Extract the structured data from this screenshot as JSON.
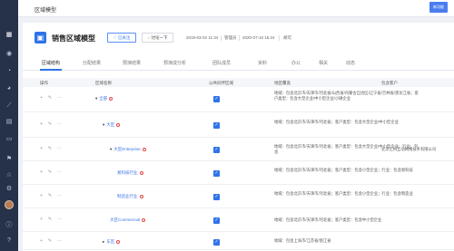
{
  "top": {
    "title": "区域模型",
    "badge": "新功能"
  },
  "sidebar": {
    "icons": [
      "grid-icon",
      "user-icon",
      "clock-icon",
      "pie-icon",
      "chart-line-icon",
      "list-icon",
      "monitor-icon",
      "flag-icon",
      "star-icon",
      "gear-icon",
      "info-icon"
    ]
  },
  "header": {
    "model_name": "销售区域模型",
    "follow": "已关注",
    "discuss": "讨论一下",
    "created": "2019-03-02 11:34",
    "updated_by": "管理员",
    "updated": "2020-07-10 16:24",
    "owner": "胡可"
  },
  "tabs": [
    "区域结构",
    "分配结果",
    "预演结果",
    "预演成分析",
    "团队成员",
    "资料",
    "办公",
    "相关",
    "动态"
  ],
  "table": {
    "headers": [
      "操作",
      "区域名称",
      "公共同伴区域",
      "地区覆盖",
      "包含客户"
    ],
    "rows": [
      {
        "name": "全部",
        "arrow": "▾",
        "cover": "地域：包含北京市/天津市/河北省/山西省/内蒙古自治区/辽宁省/吉林省/黑龙江省；客户类型：包含大型企业/中小型企业/小微企业",
        "client": ""
      },
      {
        "name": "大区",
        "arrow": "▾",
        "cover": "地域：包含北京市/天津市/河北省；客户类型：包含大型企业/中小型企业",
        "client": ""
      },
      {
        "name": "大区Enterprise",
        "arrow": "▾",
        "cover": "地域：包含北京市/天津市/河北省；客户类型：包含大型企业/中小型企业；行业：包含",
        "client": "北京汇科互动网络技术有限公司"
      },
      {
        "name": "易科技行业",
        "arrow": "",
        "cover": "地域：包含北京市/天津市/河北省；客户类型：包含小型企业；行业：包含易科技",
        "client": ""
      },
      {
        "name": "制造业行业",
        "arrow": "",
        "cover": "地域：包含北京市/天津市/河北省；客户类型：包含小型企业；行业：包含制造业",
        "client": ""
      },
      {
        "name": "大区Commercial",
        "arrow": "",
        "cover": "地域：包含北京市/天津市/河北省；客户类型：包含中小型企业",
        "client": ""
      },
      {
        "name": "东区",
        "arrow": "▸",
        "cover": "地域：包含上海市/江苏省/浙江省",
        "client": ""
      }
    ]
  },
  "colors": {
    "accent": "#2f73e8",
    "sidebar": "#26324a"
  }
}
